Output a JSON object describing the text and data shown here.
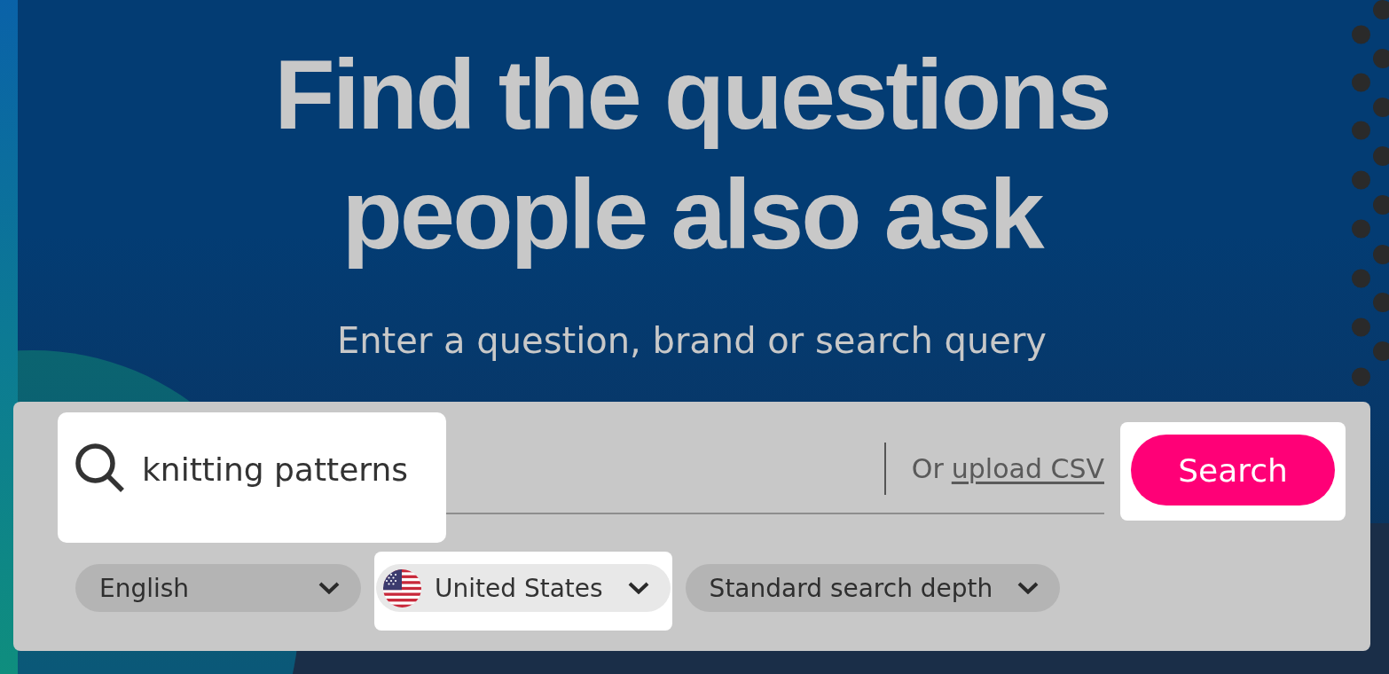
{
  "hero": {
    "title": "Find the questions people also ask",
    "subtitle": "Enter a question, brand or search query"
  },
  "search": {
    "value": "knitting patterns",
    "highlighted": true,
    "alternative": {
      "prefix": "Or",
      "link": "upload CSV"
    },
    "button": {
      "label": "Search",
      "highlighted": true
    }
  },
  "options": [
    {
      "kind": "language",
      "label": "English",
      "highlighted": false
    },
    {
      "kind": "country",
      "label": "United States",
      "highlighted": true
    },
    {
      "kind": "depth",
      "label": "Standard search depth",
      "highlighted": false
    }
  ]
}
